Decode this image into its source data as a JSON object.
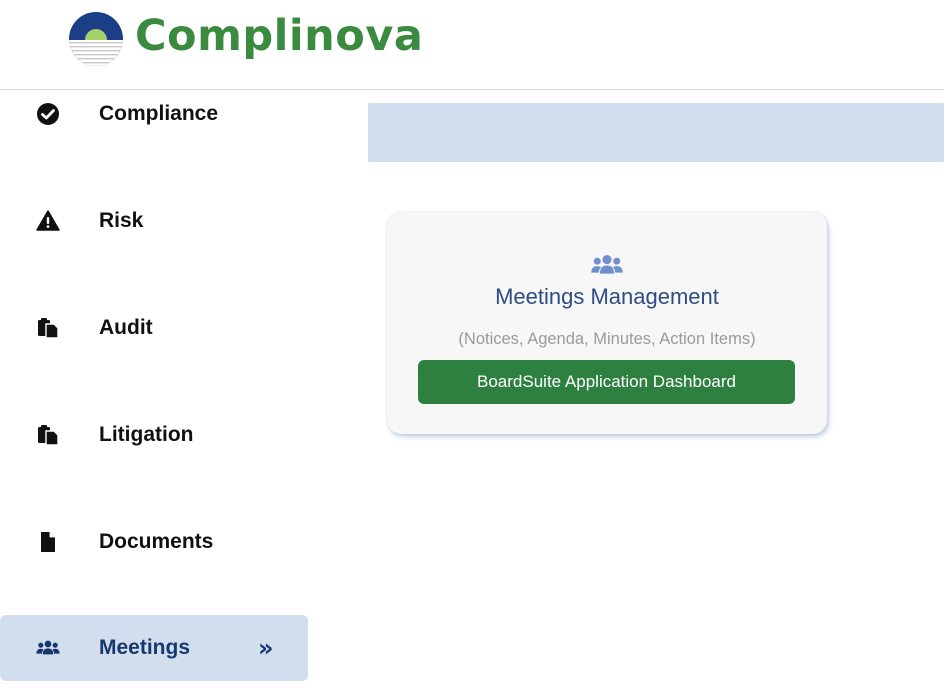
{
  "app": {
    "brand_name": "Complinova",
    "brand_color": "#3a8b3f"
  },
  "sidebar": {
    "items": [
      {
        "label": "Compliance",
        "icon": "check-circle-icon",
        "active": false
      },
      {
        "label": "Risk",
        "icon": "warning-triangle-icon",
        "active": false
      },
      {
        "label": "Audit",
        "icon": "clipboard-copy-icon",
        "active": false
      },
      {
        "label": "Litigation",
        "icon": "clipboard-copy-icon",
        "active": false
      },
      {
        "label": "Documents",
        "icon": "file-icon",
        "active": false
      },
      {
        "label": "Meetings",
        "icon": "users-icon",
        "active": true,
        "chevron": "»"
      }
    ],
    "active_bg": "#d2deed",
    "active_text": "#17386d"
  },
  "main": {
    "card": {
      "icon": "users-icon",
      "title": "Meetings Management",
      "subtitle": "(Notices, Agenda, Minutes, Action Items)",
      "button_label": "BoardSuite Application Dashboard",
      "button_color": "#2e8040"
    }
  }
}
